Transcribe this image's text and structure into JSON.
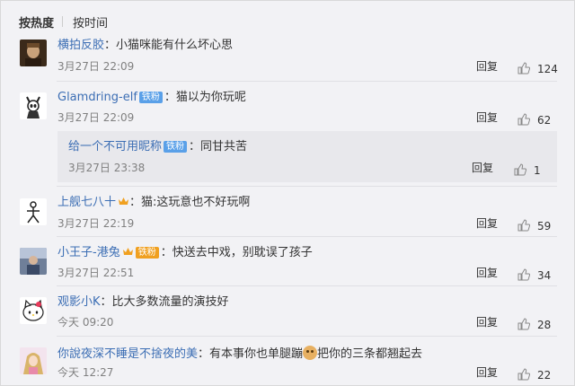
{
  "sort_tabs": {
    "hot": "按热度",
    "time": "按时间"
  },
  "colors": {
    "username": "#3c6eb4",
    "badge": "#5aa0e8",
    "meta": "#808080"
  },
  "comments": [
    {
      "user": "横拍反胶",
      "text": "小猫咪能有什么坏心思",
      "time": "3月27日 22:09",
      "reply": "回复",
      "likes": "124",
      "avatar": "portrait-avatar"
    },
    {
      "user": "Glamdring-elf",
      "badge": "铁粉",
      "text": "猫以为你玩呢",
      "time": "3月27日 22:09",
      "reply": "回复",
      "likes": "62",
      "avatar": "knight-avatar",
      "subreply": {
        "user": "给一个不可用昵称",
        "badge": "铁粉",
        "text": "同甘共苦",
        "time": "3月27日 23:38",
        "reply": "回复",
        "likes": "1"
      }
    },
    {
      "user": "上舰七八十",
      "text": "猫:这玩意也不好玩啊",
      "time": "3月27日 22:19",
      "reply": "回复",
      "likes": "59",
      "avatar": "stick-figure-avatar"
    },
    {
      "user": "小王子-港兔",
      "badge": "铁粉",
      "text": "快送去中戏，别耽误了孩子",
      "time": "3月27日 22:51",
      "reply": "回复",
      "likes": "34",
      "avatar": "photo-avatar"
    },
    {
      "user": "观影小K",
      "text": "比大多数流量的演技好",
      "time": "今天 09:20",
      "reply": "回复",
      "likes": "28",
      "avatar": "hello-kitty-avatar"
    },
    {
      "user": "你說夜深不睡是不捨夜的美",
      "text_before": "有本事你也单腿蹦",
      "text_after": "把你的三条都翘起去",
      "time": "今天 12:27",
      "reply": "回复",
      "likes": "22",
      "avatar": "anime-avatar"
    }
  ]
}
